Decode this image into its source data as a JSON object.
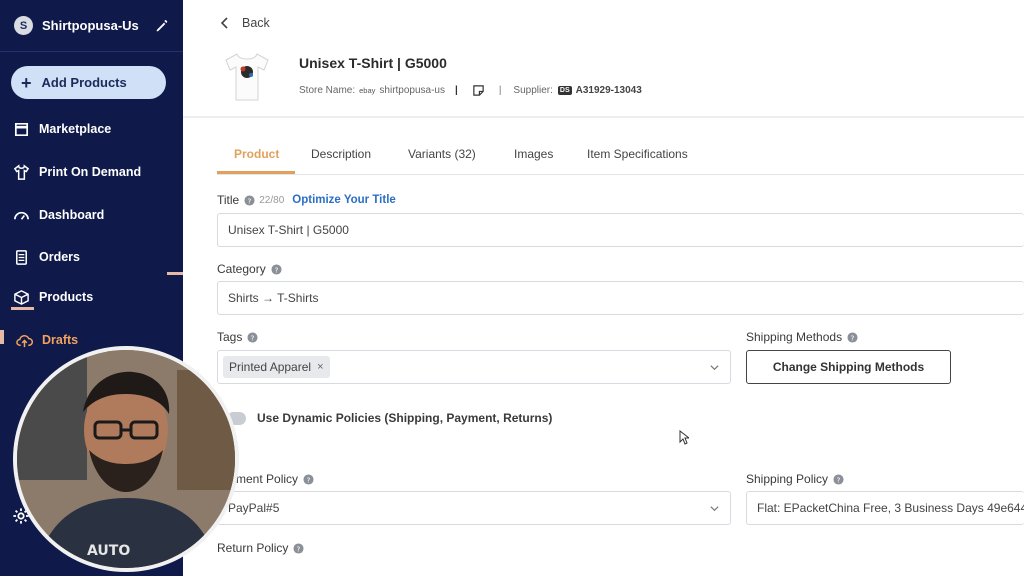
{
  "store": {
    "initial": "S",
    "name": "Shirtpopusa-Us"
  },
  "sidebar": {
    "add_products": "Add Products",
    "items": [
      {
        "label": "Marketplace",
        "icon": "store-icon"
      },
      {
        "label": "Print On Demand",
        "icon": "shirt-icon"
      },
      {
        "label": "Dashboard",
        "icon": "gauge-icon"
      },
      {
        "label": "Orders",
        "icon": "clipboard-icon"
      },
      {
        "label": "Products",
        "icon": "box-icon"
      },
      {
        "label": "Drafts",
        "icon": "cloud-upload-icon",
        "active": true
      }
    ]
  },
  "header": {
    "back": "Back",
    "product_title": "Unisex T-Shirt | G5000",
    "store_label": "Store Name:",
    "ebay": "ebay",
    "store_value": "shirtpopusa-us",
    "sep": "|",
    "supplier_label": "Supplier:",
    "supplier_badge": "DS",
    "supplier_code": "A31929-13043"
  },
  "tabs": [
    "Product",
    "Description",
    "Variants (32)",
    "Images",
    "Item Specifications"
  ],
  "form": {
    "title_label": "Title",
    "title_counter": "22/80",
    "optimize_link": "Optimize Your Title",
    "title_value": "Unisex T-Shirt | G5000",
    "category_label": "Category",
    "category_value": "Shirts → T-Shirts",
    "tags_label": "Tags",
    "tag_chip": "Printed Apparel",
    "tag_remove": "×",
    "shipping_methods_label": "Shipping Methods",
    "change_shipping_button": "Change Shipping Methods",
    "dynamic_policies_label": "Use Dynamic Policies (Shipping, Payment, Returns)",
    "payment_policy_label": "yment Policy",
    "payment_policy_value": "PayPal#5",
    "shipping_policy_label": "Shipping Policy",
    "shipping_policy_value": "Flat: EPacketChina Free, 3 Business Days 49e644",
    "return_policy_label": "Return Policy"
  },
  "colors": {
    "sidebar": "#0f1a4a",
    "accent": "#e0a15a",
    "link": "#2b6fc4"
  }
}
